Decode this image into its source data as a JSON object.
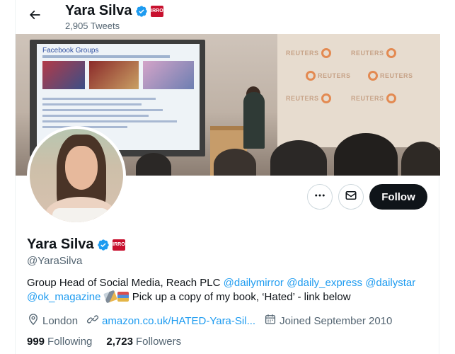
{
  "header": {
    "name": "Yara Silva",
    "tweets": "2,905 Tweets"
  },
  "banner": {
    "screen_title": "Facebook Groups",
    "wall_logo_text": "REUTERS"
  },
  "profile": {
    "name": "Yara Silva",
    "handle": "@YaraSilva",
    "affiliation_badge_text": "MIRROR",
    "bio": {
      "prefix": "Group Head of Social Media, Reach PLC ",
      "mention_1": "@dailymirror",
      "mention_2": "@daily_express",
      "mention_3": "@dailystar",
      "mention_4": "@ok_magazine",
      "suffix": " Pick up a copy of my book, ‘Hated’ - link below"
    },
    "location": "London",
    "website": "amazon.co.uk/HATED-Yara-Sil...",
    "joined": "Joined September 2010",
    "following_count": "999",
    "following_label": "Following",
    "followers_count": "2,723",
    "followers_label": "Followers"
  },
  "actions": {
    "follow_label": "Follow"
  },
  "icons": {
    "back": "arrow-left-icon",
    "more": "more-icon",
    "message": "envelope-icon",
    "location": "location-pin-icon",
    "link": "link-icon",
    "calendar": "calendar-icon",
    "verified": "verified-badge-icon"
  },
  "colors": {
    "accent": "#1d9bf0",
    "text": "#0f1419",
    "secondary_text": "#536471",
    "follow_button": "#0f1419",
    "affiliation_badge": "#c8102e"
  }
}
